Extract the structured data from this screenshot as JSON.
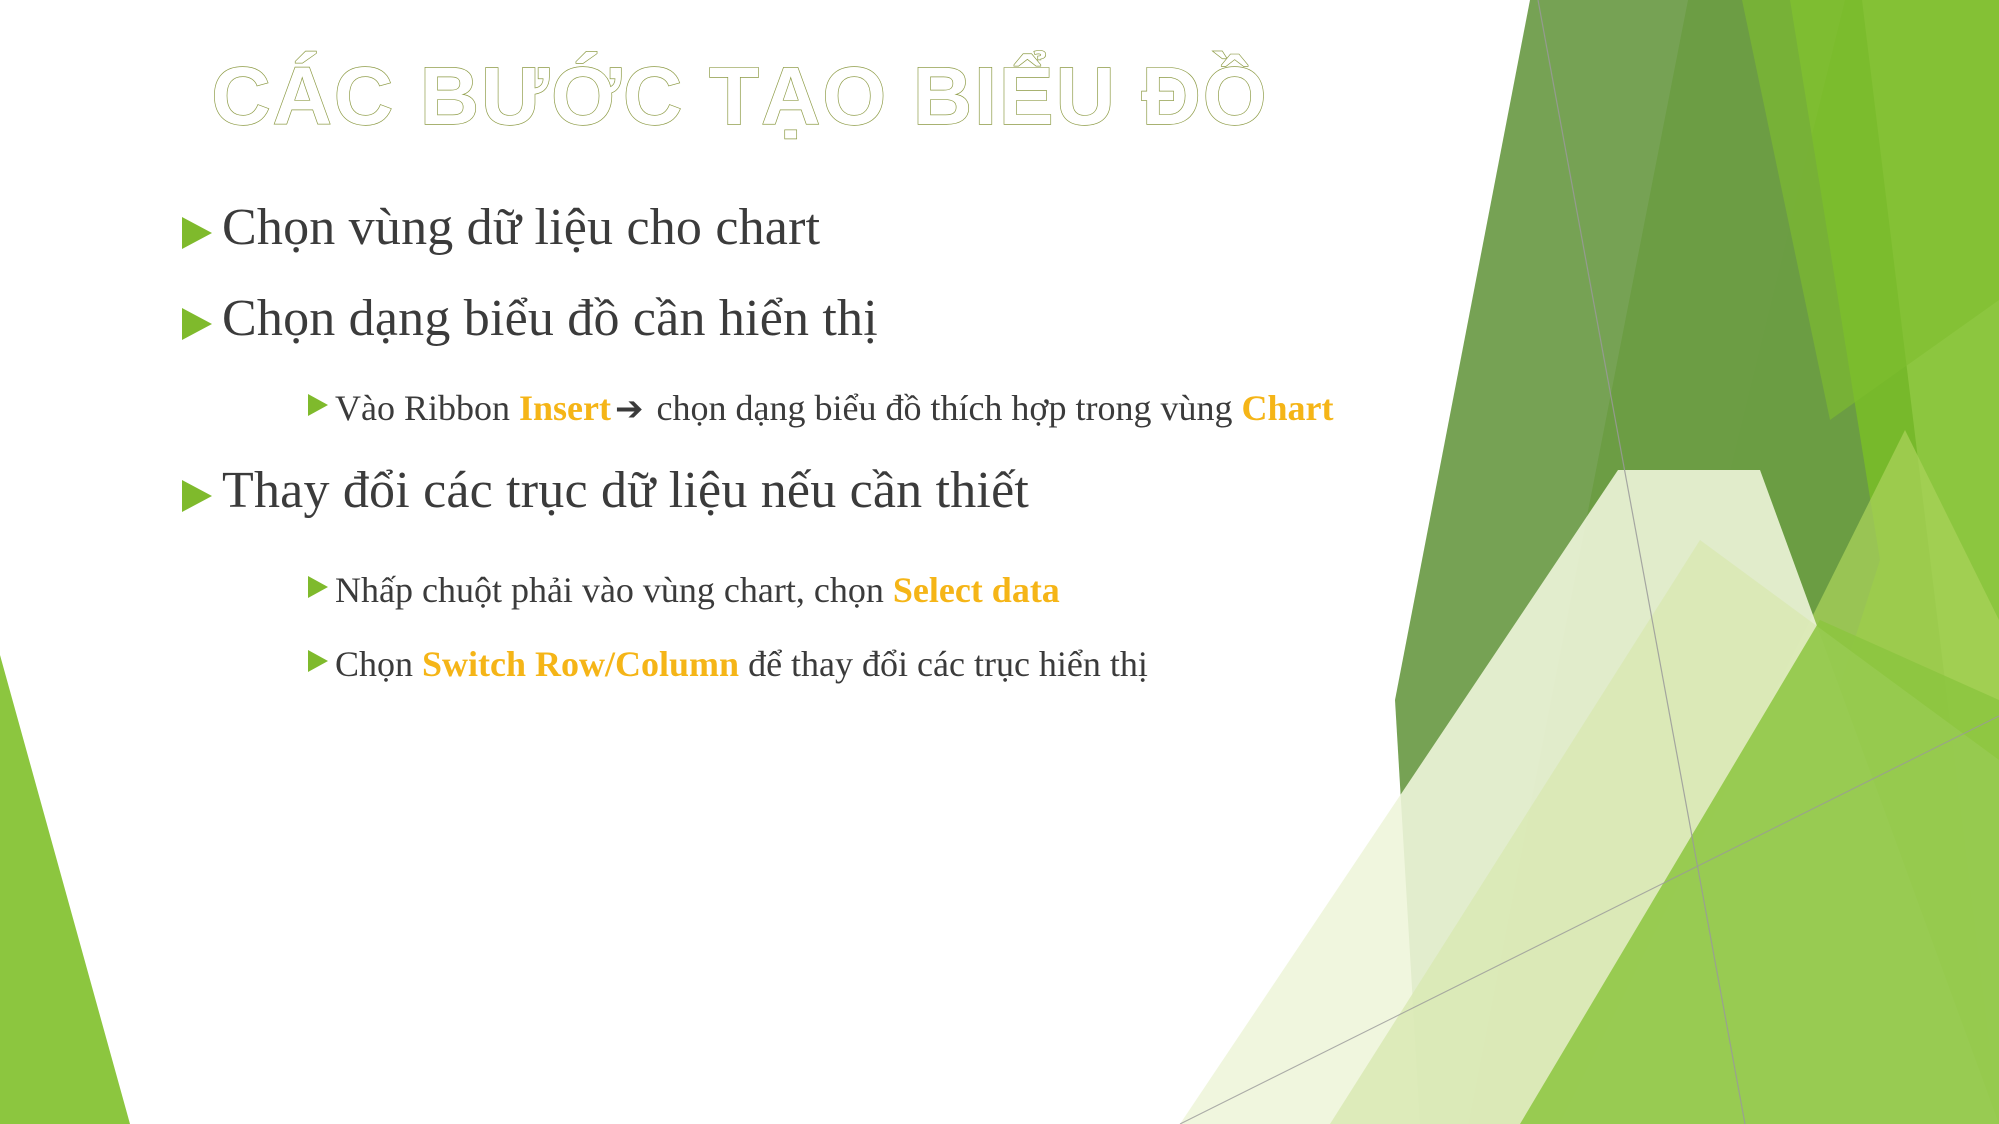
{
  "slide": {
    "title": "CÁC BƯỚC TẠO BIỂU ĐỒ",
    "title_outline_color": "#8d9b45",
    "background_color": "#ffffff",
    "bullet_color": "#7fba2c",
    "body_text_color": "#3b3b3b",
    "keyword_color": "#f5b517"
  },
  "bullets": {
    "b1": {
      "text": "Chọn vùng dữ liệu cho chart"
    },
    "b2": {
      "text": "Chọn dạng biểu đồ cần hiển thị",
      "sub": {
        "s1_pre": "Vào Ribbon ",
        "s1_kw": "Insert",
        "s1_arrow": "➔",
        "s1_post": " chọn dạng biểu đồ thích hợp trong vùng ",
        "s1_kw2": "Chart"
      }
    },
    "b3": {
      "text": "Thay đổi các trục dữ liệu nếu cần thiết",
      "sub1": {
        "pre": "Nhấp chuột phải vào vùng chart, chọn ",
        "kw": "Select data",
        "post": ""
      },
      "sub2": {
        "pre": "Chọn ",
        "kw": "Switch Row/Column",
        "post": " để thay đổi các trục hiển thị"
      }
    }
  },
  "decoration": {
    "shapes": [
      {
        "name": "left-green-wedge",
        "color": "#8cc63f"
      },
      {
        "name": "dark-green-band",
        "color": "#6a9a45"
      },
      {
        "name": "mid-green-band",
        "color": "#76b82a"
      },
      {
        "name": "bright-green-band",
        "color": "#8cc63f"
      },
      {
        "name": "pale-green-band",
        "color": "#d9e9b4"
      },
      {
        "name": "very-pale-green-band",
        "color": "#eef5da"
      },
      {
        "name": "thin-gray-line",
        "color": "#9a9a9a"
      }
    ]
  }
}
